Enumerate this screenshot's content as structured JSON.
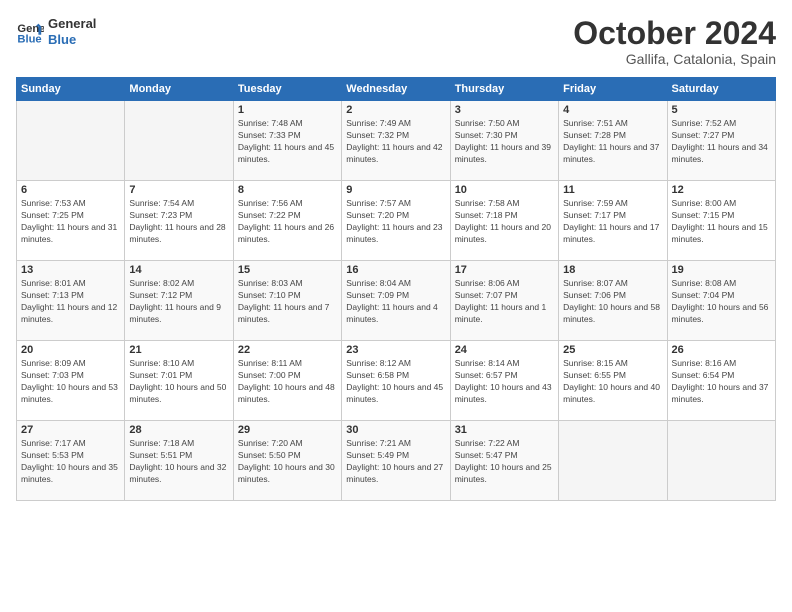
{
  "header": {
    "logo_general": "General",
    "logo_blue": "Blue",
    "month": "October 2024",
    "location": "Gallifa, Catalonia, Spain"
  },
  "weekdays": [
    "Sunday",
    "Monday",
    "Tuesday",
    "Wednesday",
    "Thursday",
    "Friday",
    "Saturday"
  ],
  "weeks": [
    [
      {
        "day": "",
        "sunrise": "",
        "sunset": "",
        "daylight": ""
      },
      {
        "day": "",
        "sunrise": "",
        "sunset": "",
        "daylight": ""
      },
      {
        "day": "1",
        "sunrise": "Sunrise: 7:48 AM",
        "sunset": "Sunset: 7:33 PM",
        "daylight": "Daylight: 11 hours and 45 minutes."
      },
      {
        "day": "2",
        "sunrise": "Sunrise: 7:49 AM",
        "sunset": "Sunset: 7:32 PM",
        "daylight": "Daylight: 11 hours and 42 minutes."
      },
      {
        "day": "3",
        "sunrise": "Sunrise: 7:50 AM",
        "sunset": "Sunset: 7:30 PM",
        "daylight": "Daylight: 11 hours and 39 minutes."
      },
      {
        "day": "4",
        "sunrise": "Sunrise: 7:51 AM",
        "sunset": "Sunset: 7:28 PM",
        "daylight": "Daylight: 11 hours and 37 minutes."
      },
      {
        "day": "5",
        "sunrise": "Sunrise: 7:52 AM",
        "sunset": "Sunset: 7:27 PM",
        "daylight": "Daylight: 11 hours and 34 minutes."
      }
    ],
    [
      {
        "day": "6",
        "sunrise": "Sunrise: 7:53 AM",
        "sunset": "Sunset: 7:25 PM",
        "daylight": "Daylight: 11 hours and 31 minutes."
      },
      {
        "day": "7",
        "sunrise": "Sunrise: 7:54 AM",
        "sunset": "Sunset: 7:23 PM",
        "daylight": "Daylight: 11 hours and 28 minutes."
      },
      {
        "day": "8",
        "sunrise": "Sunrise: 7:56 AM",
        "sunset": "Sunset: 7:22 PM",
        "daylight": "Daylight: 11 hours and 26 minutes."
      },
      {
        "day": "9",
        "sunrise": "Sunrise: 7:57 AM",
        "sunset": "Sunset: 7:20 PM",
        "daylight": "Daylight: 11 hours and 23 minutes."
      },
      {
        "day": "10",
        "sunrise": "Sunrise: 7:58 AM",
        "sunset": "Sunset: 7:18 PM",
        "daylight": "Daylight: 11 hours and 20 minutes."
      },
      {
        "day": "11",
        "sunrise": "Sunrise: 7:59 AM",
        "sunset": "Sunset: 7:17 PM",
        "daylight": "Daylight: 11 hours and 17 minutes."
      },
      {
        "day": "12",
        "sunrise": "Sunrise: 8:00 AM",
        "sunset": "Sunset: 7:15 PM",
        "daylight": "Daylight: 11 hours and 15 minutes."
      }
    ],
    [
      {
        "day": "13",
        "sunrise": "Sunrise: 8:01 AM",
        "sunset": "Sunset: 7:13 PM",
        "daylight": "Daylight: 11 hours and 12 minutes."
      },
      {
        "day": "14",
        "sunrise": "Sunrise: 8:02 AM",
        "sunset": "Sunset: 7:12 PM",
        "daylight": "Daylight: 11 hours and 9 minutes."
      },
      {
        "day": "15",
        "sunrise": "Sunrise: 8:03 AM",
        "sunset": "Sunset: 7:10 PM",
        "daylight": "Daylight: 11 hours and 7 minutes."
      },
      {
        "day": "16",
        "sunrise": "Sunrise: 8:04 AM",
        "sunset": "Sunset: 7:09 PM",
        "daylight": "Daylight: 11 hours and 4 minutes."
      },
      {
        "day": "17",
        "sunrise": "Sunrise: 8:06 AM",
        "sunset": "Sunset: 7:07 PM",
        "daylight": "Daylight: 11 hours and 1 minute."
      },
      {
        "day": "18",
        "sunrise": "Sunrise: 8:07 AM",
        "sunset": "Sunset: 7:06 PM",
        "daylight": "Daylight: 10 hours and 58 minutes."
      },
      {
        "day": "19",
        "sunrise": "Sunrise: 8:08 AM",
        "sunset": "Sunset: 7:04 PM",
        "daylight": "Daylight: 10 hours and 56 minutes."
      }
    ],
    [
      {
        "day": "20",
        "sunrise": "Sunrise: 8:09 AM",
        "sunset": "Sunset: 7:03 PM",
        "daylight": "Daylight: 10 hours and 53 minutes."
      },
      {
        "day": "21",
        "sunrise": "Sunrise: 8:10 AM",
        "sunset": "Sunset: 7:01 PM",
        "daylight": "Daylight: 10 hours and 50 minutes."
      },
      {
        "day": "22",
        "sunrise": "Sunrise: 8:11 AM",
        "sunset": "Sunset: 7:00 PM",
        "daylight": "Daylight: 10 hours and 48 minutes."
      },
      {
        "day": "23",
        "sunrise": "Sunrise: 8:12 AM",
        "sunset": "Sunset: 6:58 PM",
        "daylight": "Daylight: 10 hours and 45 minutes."
      },
      {
        "day": "24",
        "sunrise": "Sunrise: 8:14 AM",
        "sunset": "Sunset: 6:57 PM",
        "daylight": "Daylight: 10 hours and 43 minutes."
      },
      {
        "day": "25",
        "sunrise": "Sunrise: 8:15 AM",
        "sunset": "Sunset: 6:55 PM",
        "daylight": "Daylight: 10 hours and 40 minutes."
      },
      {
        "day": "26",
        "sunrise": "Sunrise: 8:16 AM",
        "sunset": "Sunset: 6:54 PM",
        "daylight": "Daylight: 10 hours and 37 minutes."
      }
    ],
    [
      {
        "day": "27",
        "sunrise": "Sunrise: 7:17 AM",
        "sunset": "Sunset: 5:53 PM",
        "daylight": "Daylight: 10 hours and 35 minutes."
      },
      {
        "day": "28",
        "sunrise": "Sunrise: 7:18 AM",
        "sunset": "Sunset: 5:51 PM",
        "daylight": "Daylight: 10 hours and 32 minutes."
      },
      {
        "day": "29",
        "sunrise": "Sunrise: 7:20 AM",
        "sunset": "Sunset: 5:50 PM",
        "daylight": "Daylight: 10 hours and 30 minutes."
      },
      {
        "day": "30",
        "sunrise": "Sunrise: 7:21 AM",
        "sunset": "Sunset: 5:49 PM",
        "daylight": "Daylight: 10 hours and 27 minutes."
      },
      {
        "day": "31",
        "sunrise": "Sunrise: 7:22 AM",
        "sunset": "Sunset: 5:47 PM",
        "daylight": "Daylight: 10 hours and 25 minutes."
      },
      {
        "day": "",
        "sunrise": "",
        "sunset": "",
        "daylight": ""
      },
      {
        "day": "",
        "sunrise": "",
        "sunset": "",
        "daylight": ""
      }
    ]
  ]
}
